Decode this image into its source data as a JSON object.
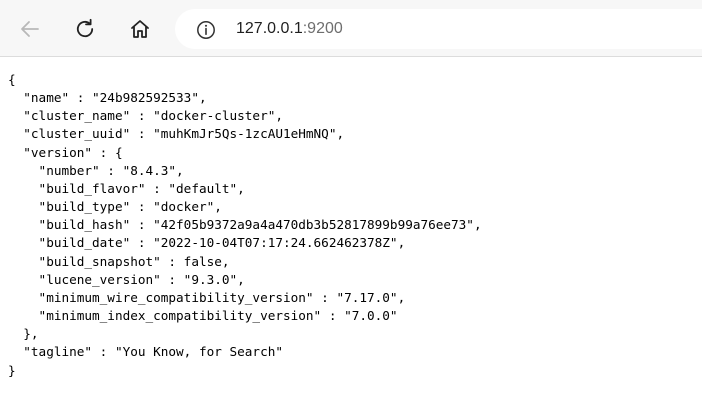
{
  "browser": {
    "back_icon": "arrow-left-icon",
    "reload_icon": "reload-icon",
    "home_icon": "home-icon",
    "site_info_icon": "info-circle-icon",
    "address": {
      "host": "127.0.0.1",
      "port": ":9200"
    }
  },
  "page": {
    "lines": [
      "{",
      "  \"name\" : \"24b982592533\",",
      "  \"cluster_name\" : \"docker-cluster\",",
      "  \"cluster_uuid\" : \"muhKmJr5Qs-1zcAU1eHmNQ\",",
      "  \"version\" : {",
      "    \"number\" : \"8.4.3\",",
      "    \"build_flavor\" : \"default\",",
      "    \"build_type\" : \"docker\",",
      "    \"build_hash\" : \"42f05b9372a9a4a470db3b52817899b99a76ee73\",",
      "    \"build_date\" : \"2022-10-04T07:17:24.662462378Z\",",
      "    \"build_snapshot\" : false,",
      "    \"lucene_version\" : \"9.3.0\",",
      "    \"minimum_wire_compatibility_version\" : \"7.17.0\",",
      "    \"minimum_index_compatibility_version\" : \"7.0.0\"",
      "  },",
      "  \"tagline\" : \"You Know, for Search\"",
      "}"
    ]
  }
}
